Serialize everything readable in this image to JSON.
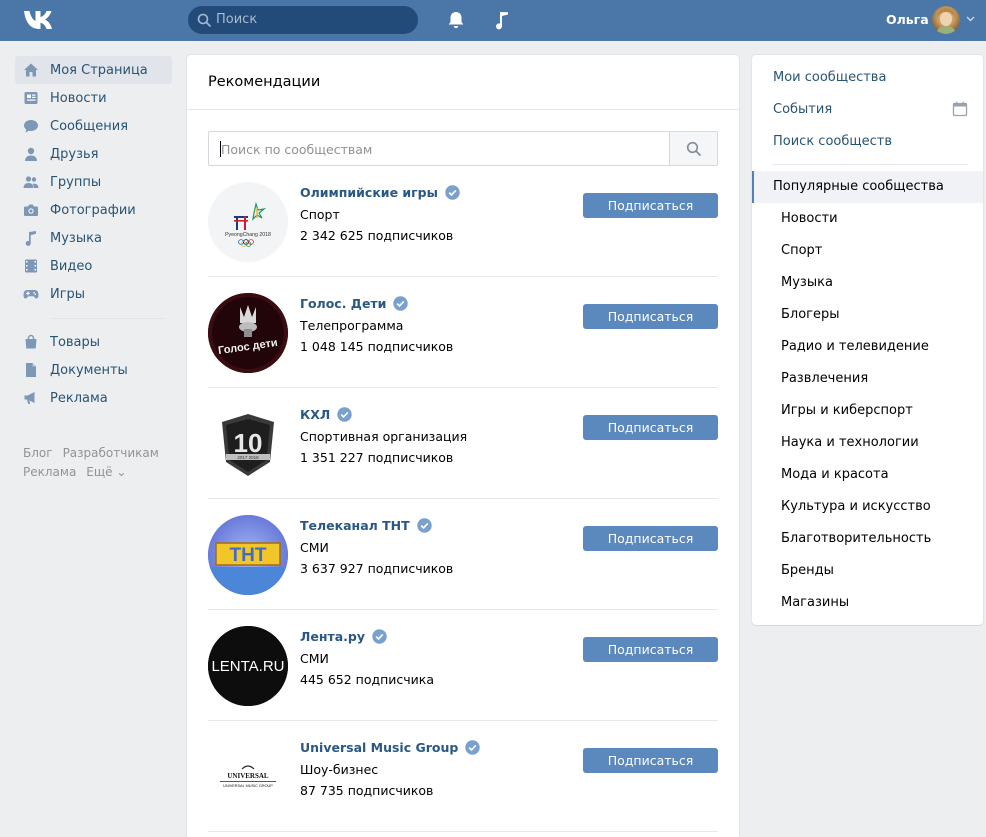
{
  "header": {
    "search_placeholder": "Поиск",
    "user_name": "Ольга",
    "logo_icon": "vk-logo-icon"
  },
  "nav": {
    "items": [
      {
        "label": "Моя Страница",
        "icon": "home-icon",
        "active": true
      },
      {
        "label": "Новости",
        "icon": "news-icon"
      },
      {
        "label": "Сообщения",
        "icon": "messages-icon"
      },
      {
        "label": "Друзья",
        "icon": "friends-icon"
      },
      {
        "label": "Группы",
        "icon": "groups-icon"
      },
      {
        "label": "Фотографии",
        "icon": "camera-icon"
      },
      {
        "label": "Музыка",
        "icon": "music-icon"
      },
      {
        "label": "Видео",
        "icon": "video-icon"
      },
      {
        "label": "Игры",
        "icon": "gamepad-icon"
      }
    ],
    "items2": [
      {
        "label": "Товары",
        "icon": "bag-icon"
      },
      {
        "label": "Документы",
        "icon": "document-icon"
      },
      {
        "label": "Реклама",
        "icon": "megaphone-icon"
      }
    ],
    "footer": [
      "Блог",
      "Разработчикам",
      "Реклама",
      "Ещё ⌄"
    ]
  },
  "main": {
    "title": "Рекомендации",
    "search_placeholder": "Поиск по сообществам",
    "subscribe_label": "Подписаться",
    "communities": [
      {
        "name": "Олимпийские игры",
        "category": "Спорт",
        "subscribers": "2 342 625 подписчиков",
        "logo": "pyeongchang-logo-icon"
      },
      {
        "name": "Голос. Дети",
        "category": "Телепрограмма",
        "subscribers": "1 048 145 подписчиков",
        "logo": "golos-logo-icon"
      },
      {
        "name": "КХЛ",
        "category": "Спортивная организация",
        "subscribers": "1 351 227 подписчиков",
        "logo": "khl-logo-icon"
      },
      {
        "name": "Телеканал ТНТ",
        "category": "СМИ",
        "subscribers": "3 637 927 подписчиков",
        "logo": "tnt-logo-icon"
      },
      {
        "name": "Лента.ру",
        "category": "СМИ",
        "subscribers": "445 652 подписчика",
        "logo": "lenta-logo-icon"
      },
      {
        "name": "Universal Music Group",
        "category": "Шоу-бизнес",
        "subscribers": "87 735 подписчиков",
        "logo": "universal-logo-icon"
      }
    ]
  },
  "right": {
    "links": [
      "Мои сообщества",
      "События",
      "Поиск сообществ"
    ],
    "active": "Популярные сообщества",
    "categories": [
      "Новости",
      "Спорт",
      "Музыка",
      "Блогеры",
      "Радио и телевидение",
      "Развлечения",
      "Игры и киберспорт",
      "Наука и технологии",
      "Мода и красота",
      "Культура и искусство",
      "Благотворительность",
      "Бренды",
      "Магазины"
    ]
  },
  "logo_texts": {
    "pyeongchang": "PyeongChang 2018",
    "golos": "Голос дети",
    "khl_number": "10",
    "khl_years": "2017 2018",
    "tnt": "ТНТ",
    "lenta": "LENTA.RU",
    "universal": "UNIVERSAL",
    "umg": "UNIVERSAL MUSIC GROUP"
  },
  "colors": {
    "header": "#4a76a8",
    "link": "#2a5885",
    "button": "#5b88bd",
    "background": "#edeef0"
  }
}
